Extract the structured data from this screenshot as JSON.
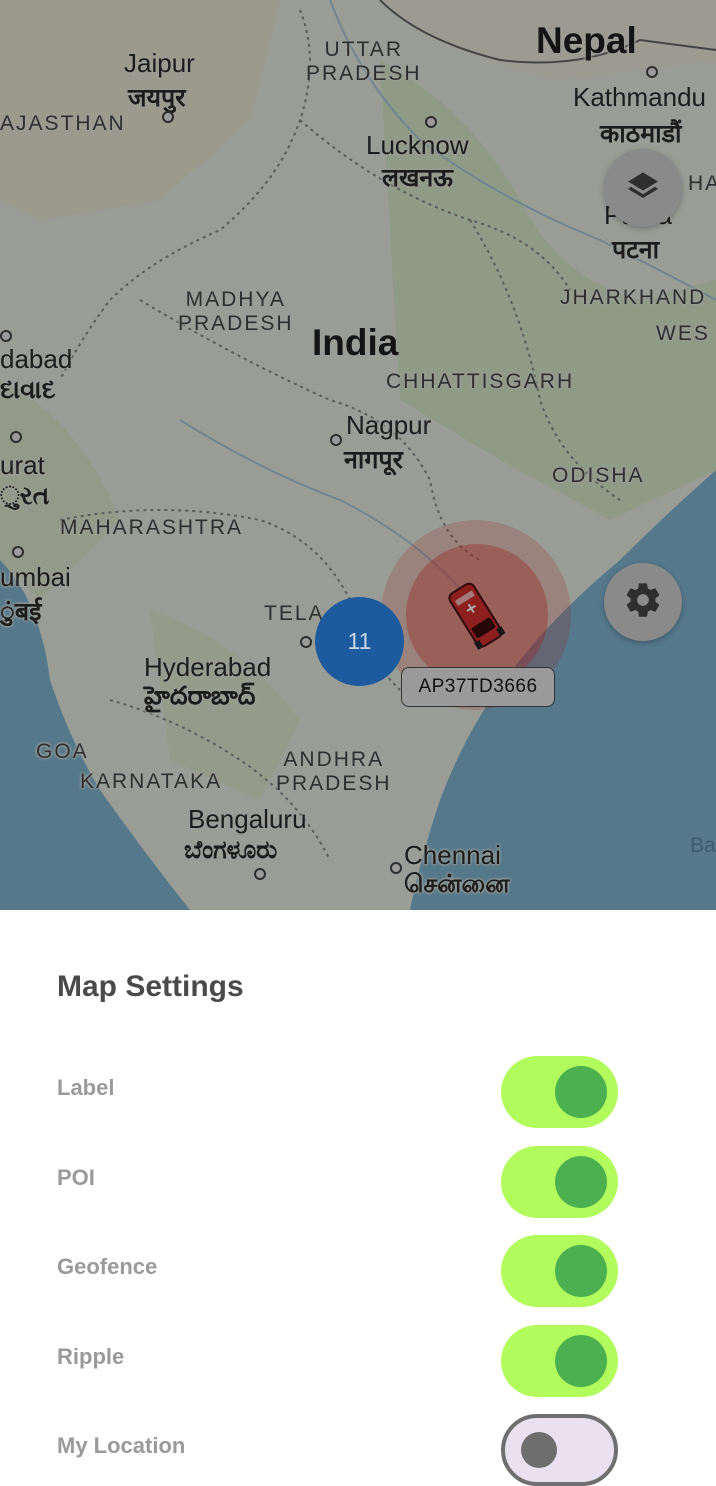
{
  "map": {
    "places": {
      "nepal": "Nepal",
      "kathmandu": "Kathmandu",
      "kathmandu_native": "काठमाडौं",
      "uttar_pradesh": "UTTAR\nPRADESH",
      "jaipur": "Jaipur",
      "jaipur_native": "जयपुर",
      "rajasthan": "AJASTHAN",
      "lucknow": "Lucknow",
      "lucknow_native": "लखनऊ",
      "patna_partial": "HA",
      "patna": "Patna",
      "patna_native": "पटना",
      "madhya_pradesh": "MADHYA\nPRADESH",
      "jharkhand": "JHARKHAND",
      "west_partial": "WES",
      "ahmedabad_partial": "dabad",
      "ahmedabad_native_partial": "દાવાદ",
      "india": "India",
      "chhattisgarh": "CHHATTISGARH",
      "nagpur": "Nagpur",
      "nagpur_native": "नागपूर",
      "surat_partial": "urat",
      "surat_native_partial": "ુરત",
      "odisha": "ODISHA",
      "maharashtra": "MAHARASHTRA",
      "mumbai_partial": "umbai",
      "mumbai_native_partial": "ुंबई",
      "telangana_partial": "TELA",
      "hyderabad": "Hyderabad",
      "hyderabad_native": "హైదరాబాద్",
      "goa": "GOA",
      "andhra_pradesh": "ANDHRA\nPRADESH",
      "karnataka": "KARNATAKA",
      "bengaluru": "Bengaluru",
      "bengaluru_native": "ಬೆಂಗಳೂರು",
      "chennai": "Chennai",
      "chennai_native": "சென்னை",
      "bay_partial": "Ba"
    },
    "cluster_count": "11",
    "vehicle_label": "AP37TD3666",
    "layers_icon": "layers-icon",
    "settings_icon": "gear-icon",
    "vehicle_icon": "car-icon"
  },
  "settings": {
    "title": "Map Settings",
    "toggles": [
      {
        "label": "Label",
        "on": true
      },
      {
        "label": "POI",
        "on": true
      },
      {
        "label": "Geofence",
        "on": true
      },
      {
        "label": "Ripple",
        "on": true
      },
      {
        "label": "My Location",
        "on": false
      }
    ]
  },
  "colors": {
    "toggle_on_track": "#b1fb5d",
    "toggle_on_knob": "#4caf50",
    "cluster": "#1d5a9e",
    "ripple": "#e53935"
  }
}
